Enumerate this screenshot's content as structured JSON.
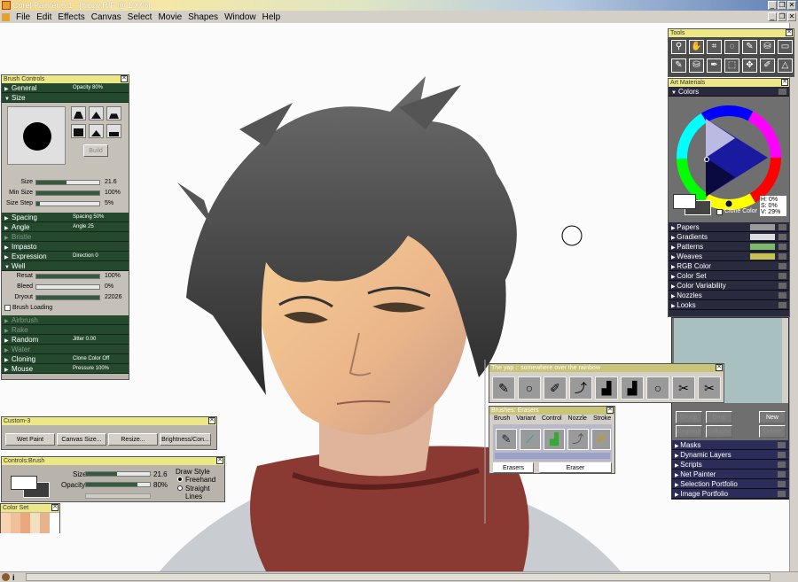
{
  "window": {
    "title": "Corel Painter 6.1 - [hippy.RIF @ 100%]"
  },
  "menu": [
    "File",
    "Edit",
    "Effects",
    "Canvas",
    "Select",
    "Movie",
    "Shapes",
    "Window",
    "Help"
  ],
  "brush_controls": {
    "title": "Brush Controls",
    "sections_top": [
      {
        "label": "General",
        "value": "Opacity 80%"
      },
      {
        "label": "Size",
        "value": ""
      }
    ],
    "build_label": "Build",
    "size_rows": [
      {
        "label": "Size",
        "value": "21.6",
        "level": 0.48
      },
      {
        "label": "Min Size",
        "value": "100%",
        "level": 1.0
      },
      {
        "label": "Size Step",
        "value": "5%",
        "level": 0.05
      }
    ],
    "sections_mid": [
      {
        "label": "Spacing",
        "value": "Spacing 50%",
        "disabled": false
      },
      {
        "label": "Angle",
        "value": "Angle 25",
        "disabled": false
      },
      {
        "label": "Bristle",
        "value": "",
        "disabled": true
      },
      {
        "label": "Impasto",
        "value": "",
        "disabled": false
      },
      {
        "label": "Expression",
        "value": "Direction 0",
        "disabled": false
      },
      {
        "label": "Well",
        "value": "",
        "disabled": false
      }
    ],
    "well_rows": [
      {
        "label": "Resat",
        "value": "100%",
        "level": 1.0
      },
      {
        "label": "Bleed",
        "value": "0%",
        "level": 0.0
      },
      {
        "label": "Dryout",
        "value": "22026",
        "level": 1.0
      }
    ],
    "brush_loading": "Brush Loading",
    "sections_bot": [
      {
        "label": "Airbrush",
        "value": "",
        "disabled": true
      },
      {
        "label": "Rake",
        "value": "",
        "disabled": true
      },
      {
        "label": "Random",
        "value": "Jitter 0.00",
        "disabled": false
      },
      {
        "label": "Water",
        "value": "",
        "disabled": true
      },
      {
        "label": "Cloning",
        "value": "Clone Color Off",
        "disabled": false
      },
      {
        "label": "Mouse",
        "value": "Pressure 100%",
        "disabled": false
      }
    ]
  },
  "custom": {
    "title": "Custom-3",
    "buttons": [
      "Wet Paint",
      "Canvas Size...",
      "Resize...",
      "Brightness/Con..."
    ]
  },
  "controls_brush": {
    "title": "Controls:Brush",
    "size_label": "Size",
    "size_value": "21.6",
    "size_level": 0.48,
    "opacity_label": "Opacity",
    "opacity_value": "80%",
    "opacity_level": 0.8,
    "draw_style": "Draw Style",
    "freehand": "Freehand",
    "straight": "Straight Lines"
  },
  "color_set": {
    "title": "Color Set",
    "colors": [
      "#f7d3b0",
      "#f0c09a",
      "#eaa87c",
      "#f2e0c2",
      "#e8b38a",
      "#ffffff"
    ]
  },
  "tools": {
    "title": "Tools",
    "row1": [
      "magnifier-icon",
      "grabber-icon",
      "crop-icon",
      "lasso-icon",
      "brush-icon",
      "paint-bucket-icon",
      "rectangle-icon"
    ],
    "row2": [
      "brush-icon",
      "paint-bucket-icon",
      "dropper-icon",
      "rectangle-select-icon",
      "layer-adjuster-icon",
      "pen-icon",
      "shape-icon"
    ]
  },
  "art_materials": {
    "title": "Art Materials",
    "colors_label": "Colors",
    "clone_color": "Clone Color",
    "hsv": [
      "H:  0%",
      "S:  0%",
      "V: 29%"
    ],
    "sections": [
      {
        "label": "Papers",
        "swatch": "#9a9a9a"
      },
      {
        "label": "Gradients",
        "swatch": "#ddd"
      },
      {
        "label": "Patterns",
        "swatch": "#7cb96a"
      },
      {
        "label": "Weaves",
        "swatch": "#c9c053"
      },
      {
        "label": "RGB Color",
        "swatch": ""
      },
      {
        "label": "Color Set",
        "swatch": ""
      },
      {
        "label": "Color Variability",
        "swatch": ""
      },
      {
        "label": "Nozzles",
        "swatch": ""
      },
      {
        "label": "Looks",
        "swatch": ""
      }
    ]
  },
  "layers": {
    "buttons": [
      "Group",
      "Drop",
      "New",
      "Ungroup",
      "Collapse",
      "Delete"
    ],
    "sections": [
      "Masks",
      "Dynamic Layers",
      "Scripts",
      "Net Painter",
      "Selection Portfolio",
      "Image Portfolio"
    ]
  },
  "custom_brushes": {
    "title": "The yap :: somewhere over the rainbow"
  },
  "brushes": {
    "title": "Brushes: Erasers",
    "menu": [
      "Brush",
      "Variant",
      "Control",
      "Nozzle",
      "Stroke"
    ],
    "category": "Erasers",
    "variant": "Eraser"
  }
}
